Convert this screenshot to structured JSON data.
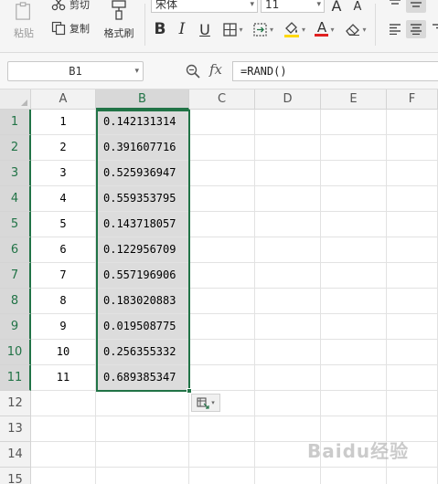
{
  "ribbon": {
    "paste_label": "粘贴",
    "cut_label": "剪切",
    "copy_label": "复制",
    "format_painter_label": "格式刷",
    "font_name": "宋体",
    "font_size": "11",
    "bold": "B",
    "italic": "I",
    "underline": "U",
    "grow_font": "A",
    "shrink_font": "A",
    "font_color_glyph": "A",
    "accent_color": "#217346",
    "font_color_bar": "#e02020",
    "fill_color_bar": "#ffd800"
  },
  "formula_bar": {
    "cell_ref": "B1",
    "fx_label": "fx",
    "formula": "=RAND()"
  },
  "sheet": {
    "columns": [
      "A",
      "B",
      "C",
      "D",
      "E",
      "F"
    ],
    "selected_column": "B",
    "rows": [
      {
        "num": "1",
        "a": "1",
        "b": "0.142131314"
      },
      {
        "num": "2",
        "a": "2",
        "b": "0.391607716"
      },
      {
        "num": "3",
        "a": "3",
        "b": "0.525936947"
      },
      {
        "num": "4",
        "a": "4",
        "b": "0.559353795"
      },
      {
        "num": "5",
        "a": "5",
        "b": "0.143718057"
      },
      {
        "num": "6",
        "a": "6",
        "b": "0.122956709"
      },
      {
        "num": "7",
        "a": "7",
        "b": "0.557196906"
      },
      {
        "num": "8",
        "a": "8",
        "b": "0.183020883"
      },
      {
        "num": "9",
        "a": "9",
        "b": "0.019508775"
      },
      {
        "num": "10",
        "a": "10",
        "b": "0.256355332"
      },
      {
        "num": "11",
        "a": "11",
        "b": "0.689385347"
      }
    ],
    "empty_rows": [
      "12",
      "13",
      "14",
      "15"
    ]
  },
  "watermark": "Baidu经验"
}
